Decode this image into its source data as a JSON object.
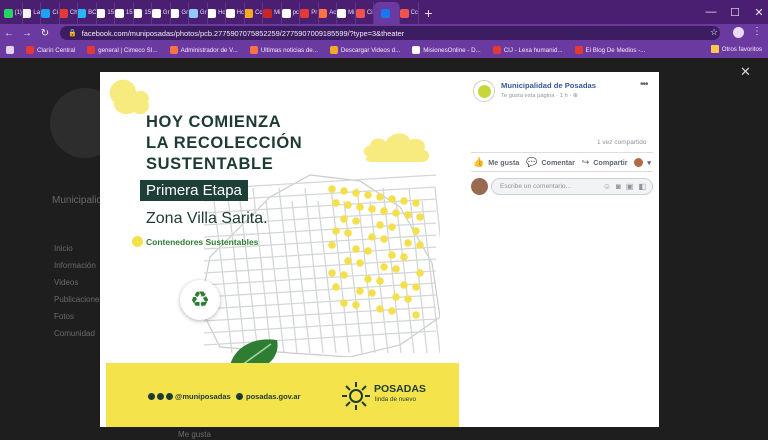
{
  "browser": {
    "tabs": [
      {
        "label": "(1)",
        "color": "#25d366"
      },
      {
        "label": "La",
        "color": "#f6f6f6"
      },
      {
        "label": "Ci",
        "color": "#1da1f2"
      },
      {
        "label": "Ch",
        "color": "#e53935"
      },
      {
        "label": "BC",
        "color": "#29b6f6"
      },
      {
        "label": "15",
        "color": "#ffffff"
      },
      {
        "label": "15",
        "color": "#ffffff"
      },
      {
        "label": "15",
        "color": "#ffffff"
      },
      {
        "label": "Gr",
        "color": "#ffffff"
      },
      {
        "label": "Gr",
        "color": "#ffffff"
      },
      {
        "label": "Gr",
        "color": "#90caf9"
      },
      {
        "label": "Hc",
        "color": "#ffffff"
      },
      {
        "label": "Hc",
        "color": "#ffffff"
      },
      {
        "label": "Cc",
        "color": "#f9a825"
      },
      {
        "label": "Mi",
        "color": "#c62828"
      },
      {
        "label": "pc",
        "color": "#ffffff"
      },
      {
        "label": "Pr",
        "color": "#e53935"
      },
      {
        "label": "Ac",
        "color": "#ff7043"
      },
      {
        "label": "Mi",
        "color": "#ffffff"
      },
      {
        "label": "Ci",
        "color": "#ef5350"
      },
      {
        "label": "",
        "color": "#1877f2",
        "active": true
      },
      {
        "label": "Cc",
        "color": "#ef5350"
      }
    ],
    "new_tab": "+",
    "url": "facebook.com/muniposadas/photos/pcb.2775907075852259/2775907009185599/?type=3&theater",
    "bookmarks": [
      {
        "label": "Clarín Central",
        "color": "#e53935"
      },
      {
        "label": "general | Cimeco SI...",
        "color": "#e53935"
      },
      {
        "label": "Administrador de V...",
        "color": "#ff7043"
      },
      {
        "label": "Ultimas noticias de...",
        "color": "#ff7043"
      },
      {
        "label": "Descargar Videos d...",
        "color": "#f9a825"
      },
      {
        "label": "MisionesOnline - D...",
        "color": "#ffffff"
      },
      {
        "label": "CIJ - Lexa humanid...",
        "color": "#e53935"
      },
      {
        "label": "El Blog De Medios -...",
        "color": "#e53935"
      }
    ],
    "bookmarks_other": "Otros favoritos"
  },
  "background_page": {
    "left_items": [
      "Inicio",
      "Información",
      "Videos",
      "Publicaciones",
      "Fotos",
      "Comunidad"
    ],
    "page_name": "Municipalidad de Posadas",
    "bottom_text": "Me gusta"
  },
  "photo": {
    "headline": [
      "HOY COMIENZA",
      "LA RECOLECCIÓN",
      "SUSTENTABLE"
    ],
    "stage": "Primera Etapa",
    "zone": "Zona Villa Sarita.",
    "legend": "Contenedores Sustentables",
    "social_handle": "@muniposadas",
    "website": "posadas.gov.ar",
    "brand_name": "POSADAS",
    "brand_tagline": "linda de nuevo",
    "accent_yellow": "#f4e34a",
    "accent_green": "#1e3f37"
  },
  "post": {
    "page_name": "Municipalidad de Posadas",
    "meta": "Te gusta esta página · 1 h ·",
    "shares": "1 vez compartido",
    "like_label": "Me gusta",
    "comment_label": "Comentar",
    "share_label": "Compartir",
    "comment_placeholder": "Escribe un comentario..."
  }
}
